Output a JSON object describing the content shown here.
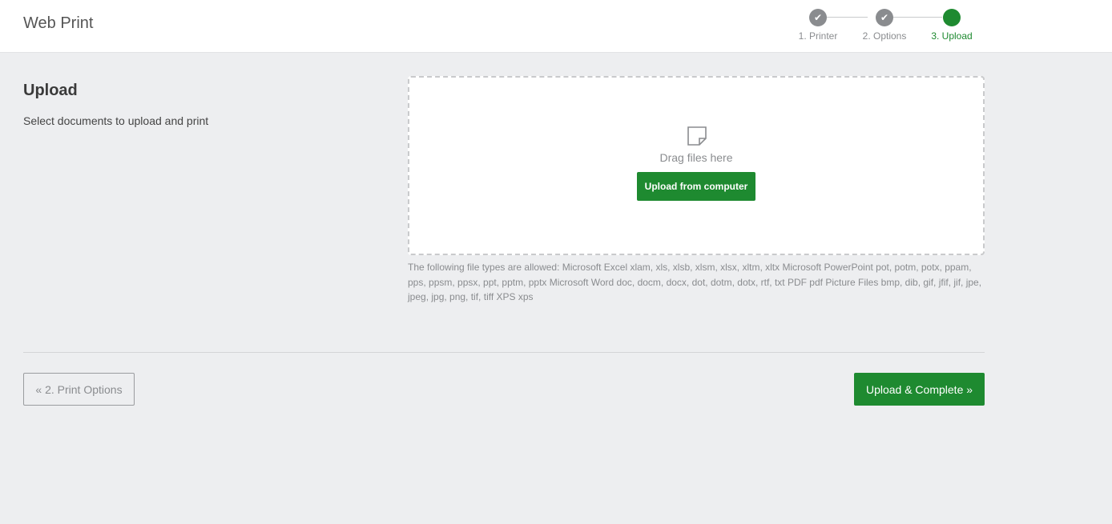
{
  "header": {
    "title": "Web Print",
    "steps": [
      {
        "label": "1. Printer",
        "state": "done",
        "icon": "check-icon"
      },
      {
        "label": "2. Options",
        "state": "done",
        "icon": "check-icon"
      },
      {
        "label": "3. Upload",
        "state": "active",
        "icon": "current-step-dot"
      }
    ],
    "check_glyph": "✔"
  },
  "main": {
    "title": "Upload",
    "description": "Select documents to upload and print",
    "dropzone": {
      "icon": "document-icon",
      "drag_text": "Drag files here",
      "upload_button": "Upload from computer"
    },
    "file_types": "The following file types are allowed: Microsoft Excel xlam, xls, xlsb, xlsm, xlsx, xltm, xltx Microsoft PowerPoint pot, potm, potx, ppam, pps, ppsm, ppsx, ppt, pptm, pptx Microsoft Word doc, docm, docx, dot, dotm, dotx, rtf, txt PDF pdf Picture Files bmp, dib, gif, jfif, jif, jpe, jpeg, jpg, png, tif, tiff XPS xps"
  },
  "footer": {
    "back_button": "« 2. Print Options",
    "complete_button": "Upload & Complete »"
  },
  "colors": {
    "accent": "#1e8a30",
    "step_done": "#8a8c8f",
    "background": "#edeef0"
  }
}
